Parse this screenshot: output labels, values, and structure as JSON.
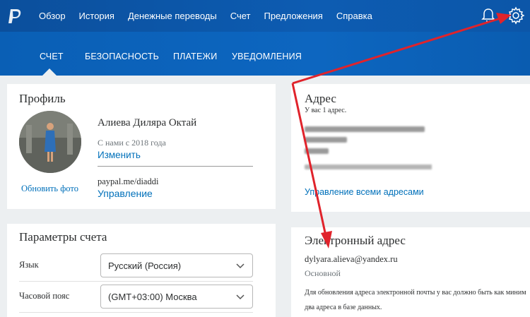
{
  "topnav": {
    "items": [
      "Обзор",
      "История",
      "Денежные переводы",
      "Счет",
      "Предложения",
      "Справка"
    ]
  },
  "subnav": {
    "items": [
      "СЧЕТ",
      "БЕЗОПАСНОСТЬ",
      "ПЛАТЕЖИ",
      "УВЕДОМЛЕНИЯ"
    ]
  },
  "profile": {
    "heading": "Профиль",
    "name": "Алиева Диляра Октай",
    "member_since": "С нами с 2018 года",
    "edit_link": "Изменить",
    "update_photo": "Обновить фото",
    "paypal_me": "paypal.me/diaddi",
    "manage_link": "Управление"
  },
  "address": {
    "heading": "Адрес",
    "count": "У вас 1 адрес.",
    "manage_all_link": "Управление всеми адресами"
  },
  "account_settings": {
    "heading": "Параметры счета",
    "language_label": "Язык",
    "language_value": "Русский (Россия)",
    "timezone_label": "Часовой пояс",
    "timezone_value": "(GMT+03:00) Москва"
  },
  "email": {
    "heading": "Электронный адрес",
    "address": "dylyara.alieva@yandex.ru",
    "status": "Основной",
    "note_line1": "Для обновления адреса электронной почты у вас должно быть как миним",
    "note_line2": "два адреса в базе данных."
  },
  "colors": {
    "topbar": "#0b4f9c",
    "subbar": "#0a5fb5",
    "link": "#0070ba",
    "annotation_arrow": "#e0232b"
  }
}
